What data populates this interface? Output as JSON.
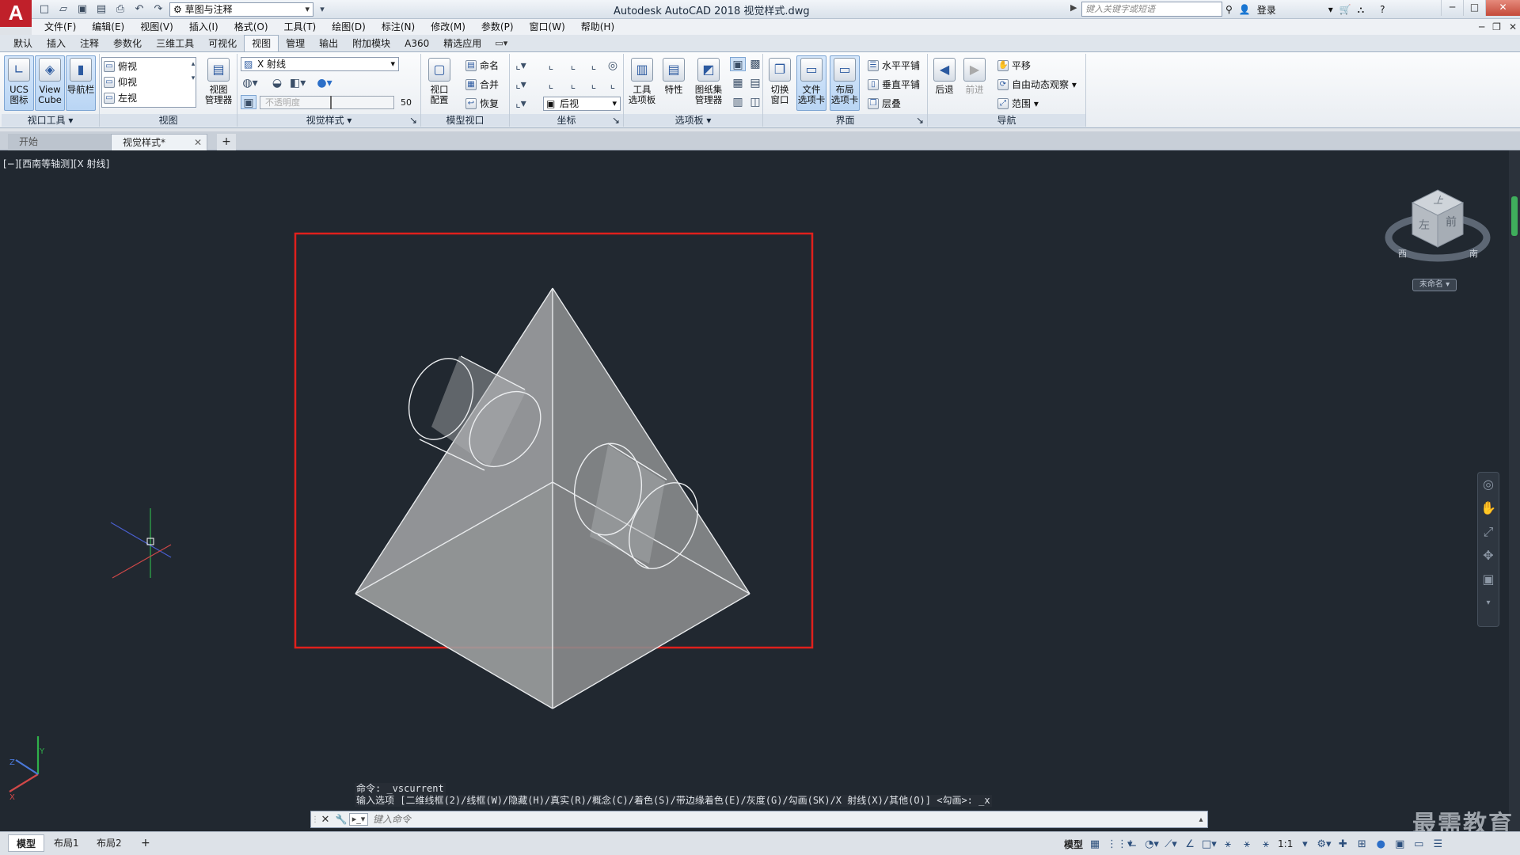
{
  "app": {
    "logo": "A",
    "title": "Autodesk AutoCAD 2018    视觉样式.dwg",
    "workspace": "草图与注释",
    "search_placeholder": "键入关键字或短语",
    "login": "登录"
  },
  "menu": [
    "文件(F)",
    "编辑(E)",
    "视图(V)",
    "插入(I)",
    "格式(O)",
    "工具(T)",
    "绘图(D)",
    "标注(N)",
    "修改(M)",
    "参数(P)",
    "窗口(W)",
    "帮助(H)"
  ],
  "ribbon_tabs": [
    "默认",
    "插入",
    "注释",
    "参数化",
    "三维工具",
    "可视化",
    "视图",
    "管理",
    "输出",
    "附加模块",
    "A360",
    "精选应用"
  ],
  "ribbon_active_tab": "视图",
  "ribbon": {
    "viewport_tools": {
      "title": "视口工具",
      "ucs_label": "UCS\n图标",
      "viewcube_label": "View\nCube",
      "navbar_label": "导航栏"
    },
    "views": {
      "title": "视图",
      "items": [
        "俯视",
        "仰视",
        "左视"
      ],
      "manager_label": "视图\n管理器"
    },
    "visual_styles": {
      "title": "视觉样式",
      "current": "X 射线",
      "opacity_label": "不透明度",
      "opacity_value": "50"
    },
    "model_viewports": {
      "title": "模型视口",
      "config_label": "视口\n配置",
      "named_label": "命名",
      "join_label": "合并",
      "restore_label": "恢复"
    },
    "coordinates": {
      "title": "坐标",
      "view_combo": "后视"
    },
    "palettes": {
      "title": "选项板",
      "tool_palettes_label": "工具\n选项板",
      "properties_label": "特性",
      "sheetset_label": "图纸集\n管理器"
    },
    "interface": {
      "title": "界面",
      "switch_window_label": "切换\n窗口",
      "file_tabs_label": "文件\n选项卡",
      "layout_tabs_label": "布局\n选项卡",
      "tile_h": "水平平铺",
      "tile_v": "垂直平铺",
      "cascade": "层叠"
    },
    "navigate": {
      "title": "导航",
      "back_label": "后退",
      "forward_label": "前进",
      "pan": "平移",
      "orbit": "自由动态观察",
      "extents": "范围"
    }
  },
  "file_tabs": {
    "start": "开始",
    "current": "视觉样式*"
  },
  "viewport": {
    "label": "[−][西南等轴测][X 射线]",
    "viewcube": {
      "top": "上",
      "front": "前",
      "left": "左",
      "west": "西",
      "south": "南",
      "ucs_label": "未命名"
    }
  },
  "command": {
    "history": [
      "命令: _vscurrent",
      "输入选项 [二维线框(2)/线框(W)/隐藏(H)/真实(R)/概念(C)/着色(S)/带边缘着色(E)/灰度(G)/勾画(SK)/X 射线(X)/其他(O)] <勾画>: _x"
    ],
    "input_placeholder": "键入命令"
  },
  "status": {
    "layout_tabs": [
      "模型",
      "布局1",
      "布局2"
    ],
    "model_label": "模型",
    "scale": "1:1"
  },
  "watermark": "最需教育",
  "colors": {
    "viewport_bg": "#212830",
    "highlight_rect": "#e0201c",
    "solid_fill": "#9a9c9e",
    "edge": "#e8eaec",
    "accent_blue": "#2c5aa0"
  }
}
